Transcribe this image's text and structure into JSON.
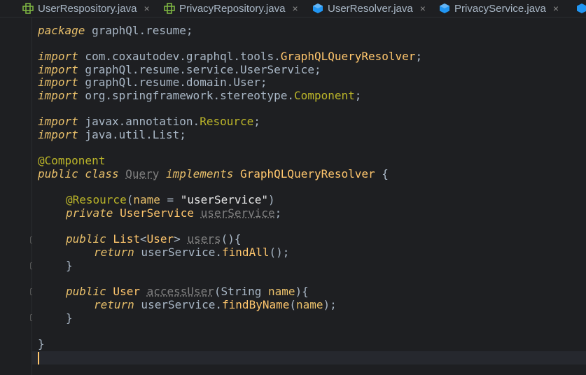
{
  "tabs": [
    {
      "label": "UserRespository.java",
      "icon": "interface-icon",
      "close": "×"
    },
    {
      "label": "PrivacyRepository.java",
      "icon": "interface-icon",
      "close": "×"
    },
    {
      "label": "UserResolver.java",
      "icon": "class-icon",
      "close": "×"
    },
    {
      "label": "PrivacyService.java",
      "icon": "class-icon",
      "close": "×"
    }
  ],
  "code": {
    "l1_kw": "package",
    "l1_rest": " graphQl.resume;",
    "l3_kw": "import",
    "l3_pkg": " com.coxautodev.graphql.tools.",
    "l3_cls": "GraphQLQueryResolver",
    "l3_end": ";",
    "l4_kw": "import",
    "l4_pkg": " graphQl.resume.service.",
    "l4_cls": "UserService",
    "l4_end": ";",
    "l5_kw": "import",
    "l5_pkg": " graphQl.resume.domain.",
    "l5_cls": "User",
    "l5_end": ";",
    "l6_kw": "import",
    "l6_pkg": " org.springframework.stereotype.",
    "l6_cls": "Component",
    "l6_end": ";",
    "l8_kw": "import",
    "l8_pkg": " javax.annotation.",
    "l8_cls": "Resource",
    "l8_end": ";",
    "l9_kw": "import",
    "l9_pkg": " java.util.",
    "l9_cls": "List",
    "l9_end": ";",
    "l11": "@Component",
    "l12_kw1": "public",
    "l12_kw2": " class ",
    "l12_name": "Query",
    "l12_kw3": " implements ",
    "l12_iface": "GraphQLQueryResolver",
    "l12_end": " {",
    "l14_ann": "@Resource",
    "l14_p1": "(",
    "l14_arg": "name",
    "l14_eq": " = ",
    "l14_str": "\"userService\"",
    "l14_p2": ")",
    "l15_kw": "private",
    "l15_ty": " UserService ",
    "l15_var": "userService",
    "l15_end": ";",
    "l17_kw": "public",
    "l17_ty": " List",
    "l17_lt": "<",
    "l17_gen": "User",
    "l17_gt": ">",
    "l17_sp": " ",
    "l17_fn": "users",
    "l17_end": "(){",
    "l18_kw": "return",
    "l18_obj": " userService.",
    "l18_call": "findAll",
    "l18_end": "();",
    "l19": "}",
    "l21_kw": "public",
    "l21_ty": " User ",
    "l21_fn": "accessUser",
    "l21_p1": "(String ",
    "l21_arg": "name",
    "l21_end": "){",
    "l22_kw": "return",
    "l22_obj": " userService.",
    "l22_call": "findByName",
    "l22_p1": "(",
    "l22_arg": "name",
    "l22_end": ");",
    "l23": "}",
    "l25": "}"
  },
  "colors": {
    "background": "#1e1f22",
    "keyword": "#cc7832",
    "class": "#ffc66d",
    "string": "#6a8759",
    "annotation": "#bbb529"
  }
}
